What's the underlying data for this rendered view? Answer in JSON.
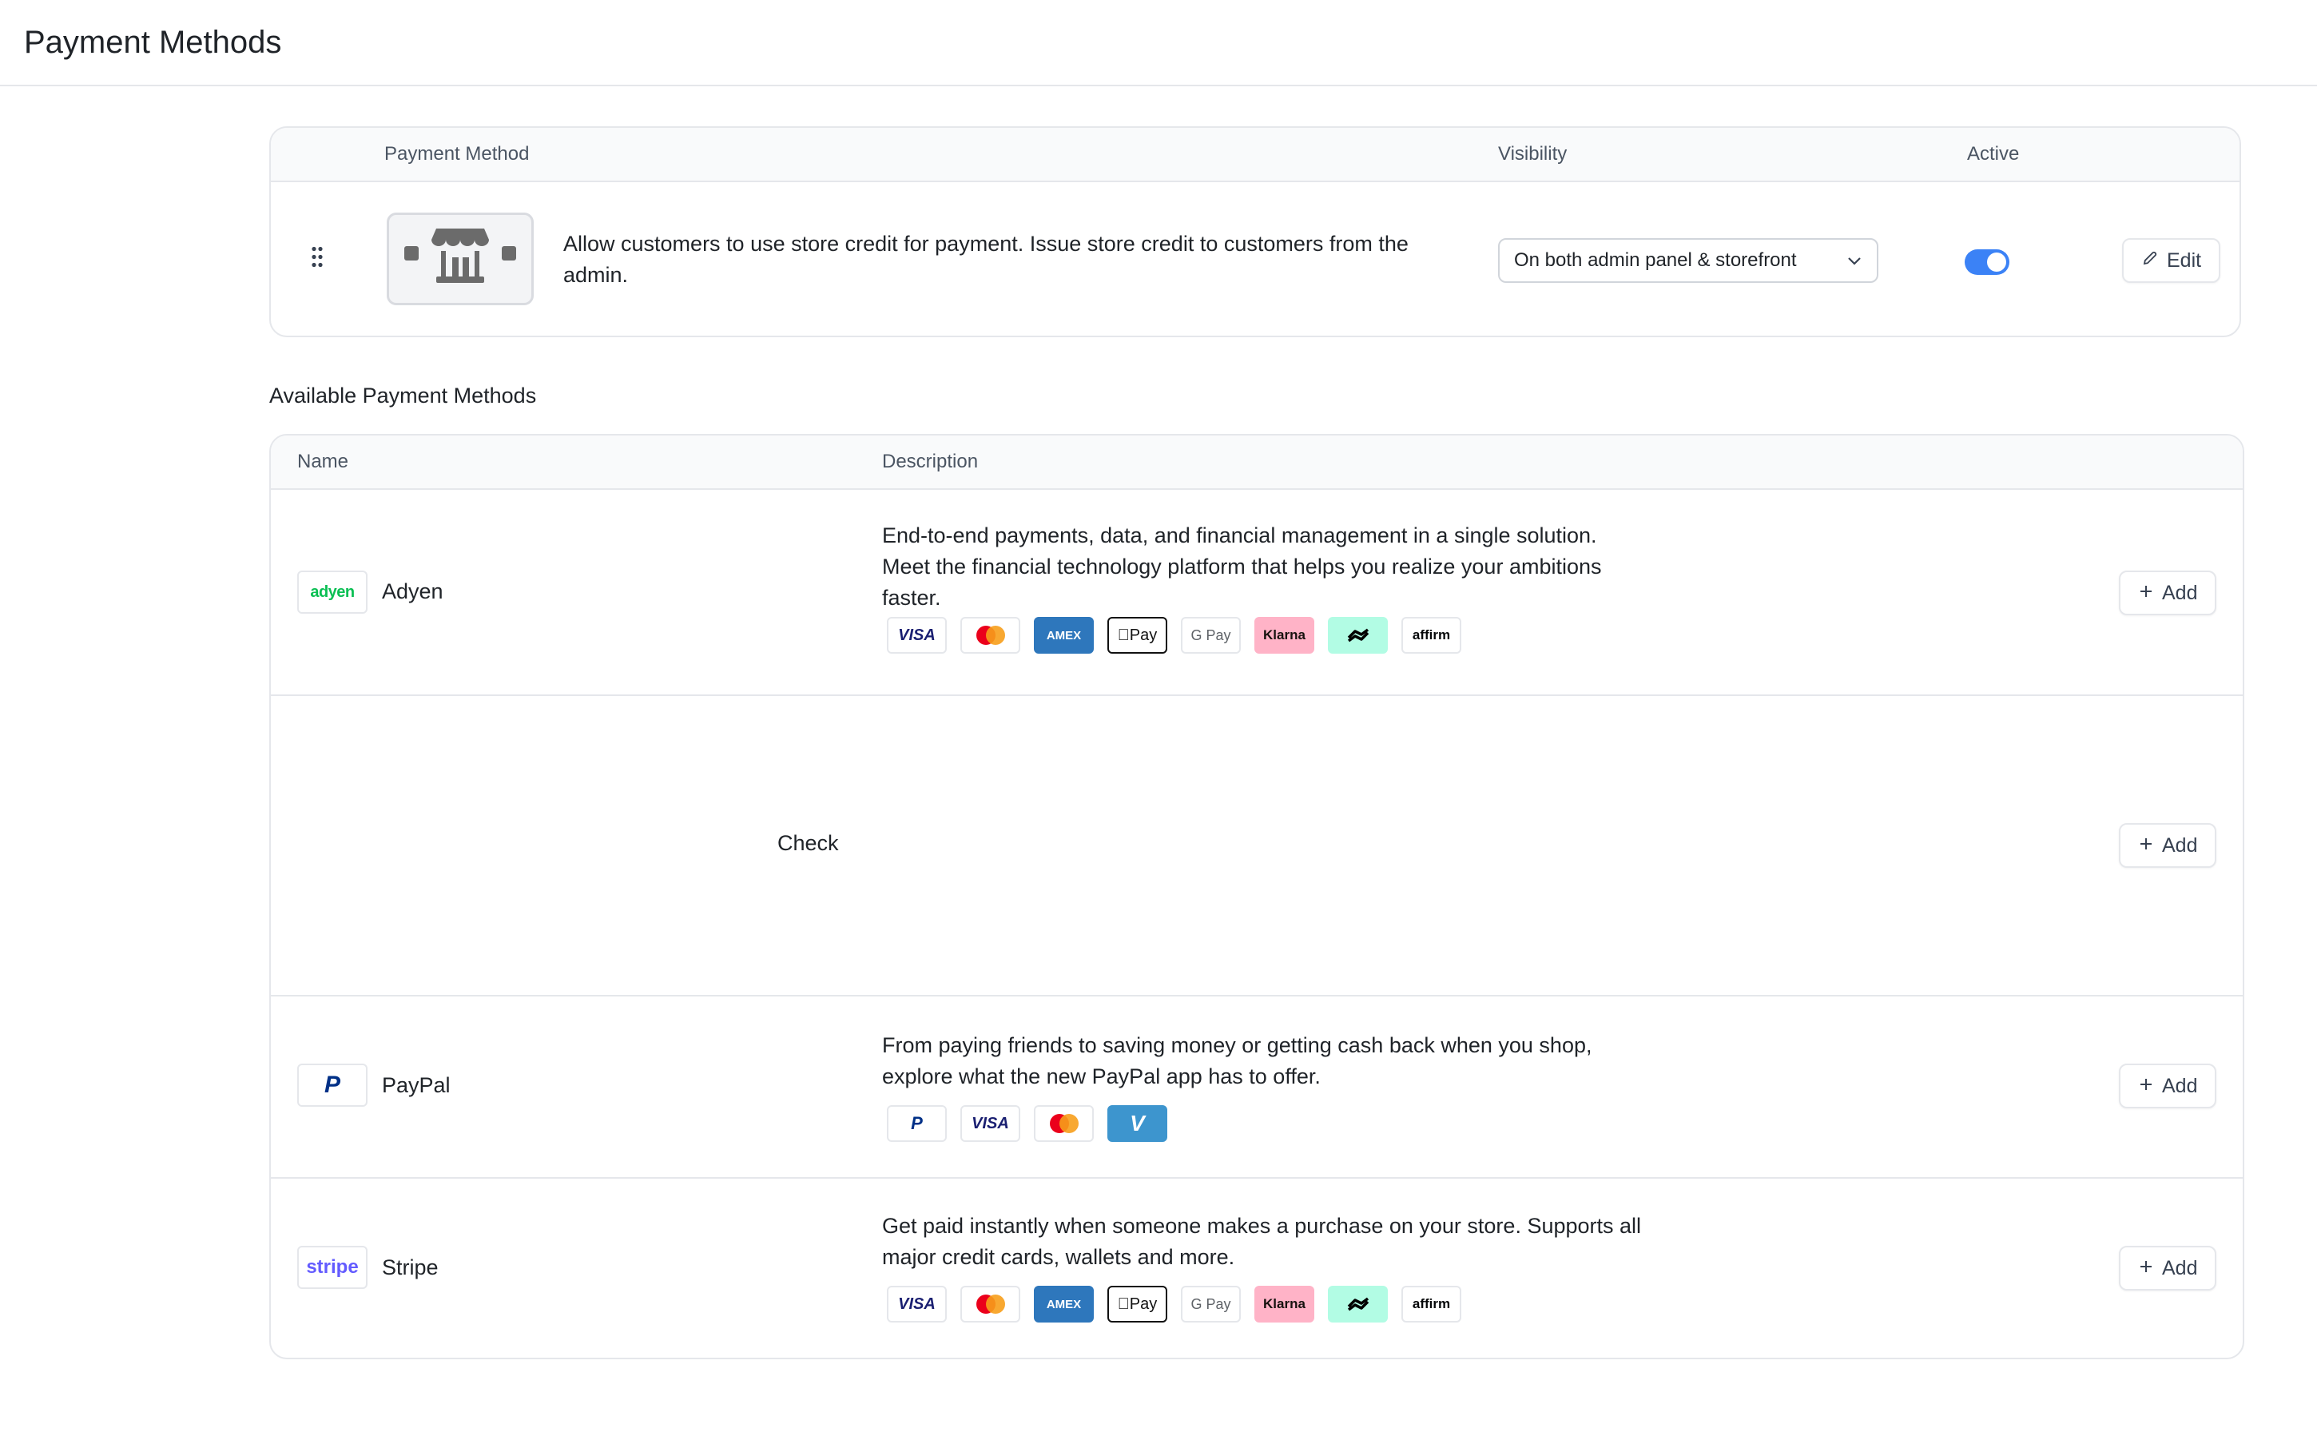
{
  "page_title": "Payment Methods",
  "active_table": {
    "headers": {
      "payment_method": "Payment Method",
      "visibility": "Visibility",
      "active": "Active"
    },
    "row": {
      "logo_icon": "storefront-icon",
      "description": "Allow customers to use store credit for payment. Issue store credit to customers from the admin.",
      "visibility_value": "On both admin panel & storefront",
      "active": true,
      "edit_label": "Edit"
    }
  },
  "available": {
    "title": "Available Payment Methods",
    "headers": {
      "name": "Name",
      "description": "Description"
    },
    "add_label": "Add",
    "methods": [
      {
        "name": "Adyen",
        "logo_text": "adyen",
        "description": "End-to-end payments, data, and financial management in a single solution. Meet the financial technology platform that helps you realize your ambitions faster.",
        "badges": [
          "VISA",
          "Mastercard",
          "AMEX",
          "Pay",
          "G Pay",
          "Klarna",
          "Afterpay",
          "affirm"
        ]
      },
      {
        "name": "Check",
        "description": "",
        "badges": []
      },
      {
        "name": "PayPal",
        "logo_text": "P",
        "description": "From paying friends to saving money or getting cash back when you shop, explore what the new PayPal app has to offer.",
        "badges": [
          "PayPal",
          "VISA",
          "Mastercard",
          "Venmo"
        ]
      },
      {
        "name": "Stripe",
        "logo_text": "stripe",
        "description": "Get paid instantly when someone makes a purchase on your store. Supports all major credit cards, wallets and more.",
        "badges": [
          "VISA",
          "Mastercard",
          "AMEX",
          "Pay",
          "G Pay",
          "Klarna",
          "Afterpay",
          "affirm"
        ]
      }
    ]
  },
  "colors": {
    "accent": "#3b82f6",
    "border": "#e5e7eb",
    "header_bg": "#f9fafb",
    "adyen_green": "#0abf53",
    "stripe_purple": "#635bff",
    "paypal_navy": "#003087",
    "klarna_pink": "#ffb3c7",
    "afterpay_mint": "#b2fce4",
    "amex_blue": "#2e77bc",
    "venmo_blue": "#3d95ce"
  }
}
